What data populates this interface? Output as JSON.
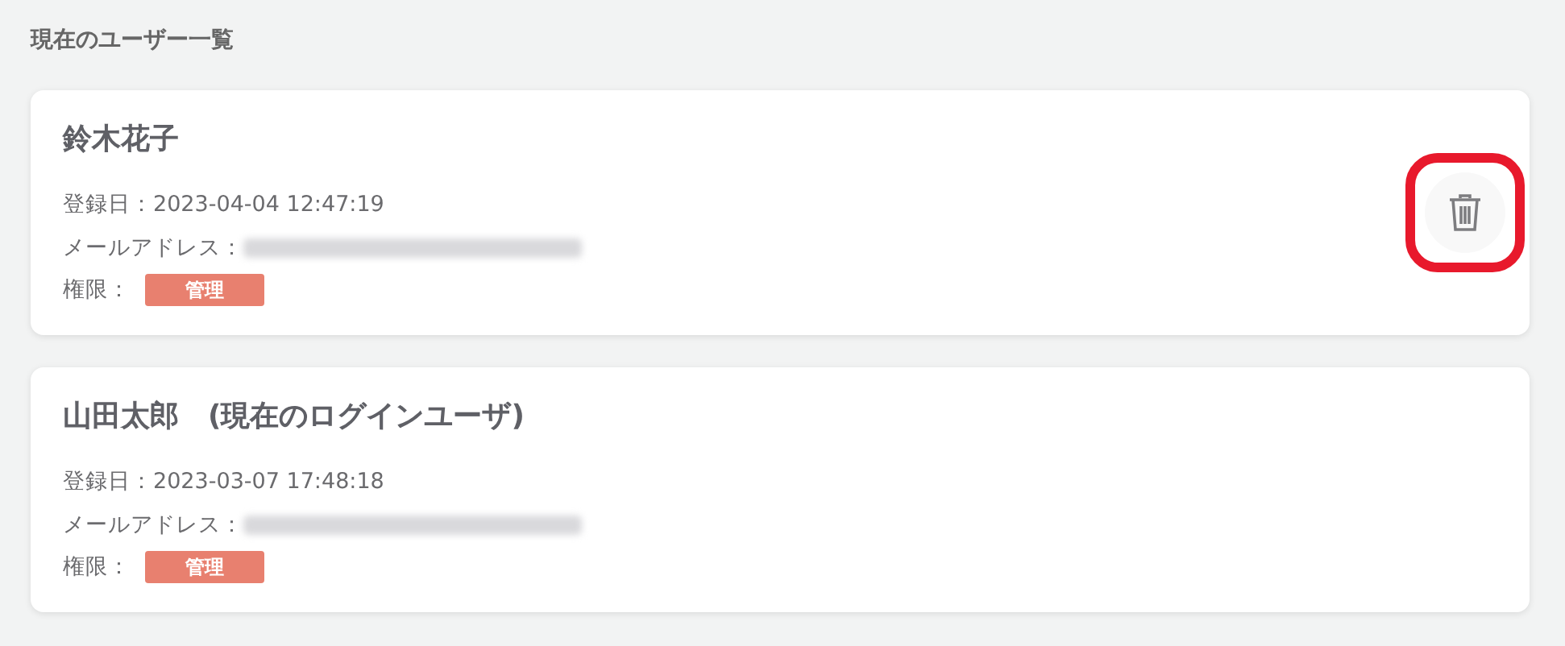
{
  "section_title": "現在のユーザー一覧",
  "users": [
    {
      "name": "鈴木花子",
      "registered": "登録日：2023-04-04 12:47:19",
      "email_label": "メールアドレス：",
      "role_label": "権限：",
      "role": "管理",
      "deletable": true,
      "highlighted": true
    },
    {
      "name": "山田太郎　(現在のログインユーザ)",
      "registered": "登録日：2023-03-07 17:48:18",
      "email_label": "メールアドレス：",
      "role_label": "権限：",
      "role": "管理",
      "deletable": false
    }
  ]
}
